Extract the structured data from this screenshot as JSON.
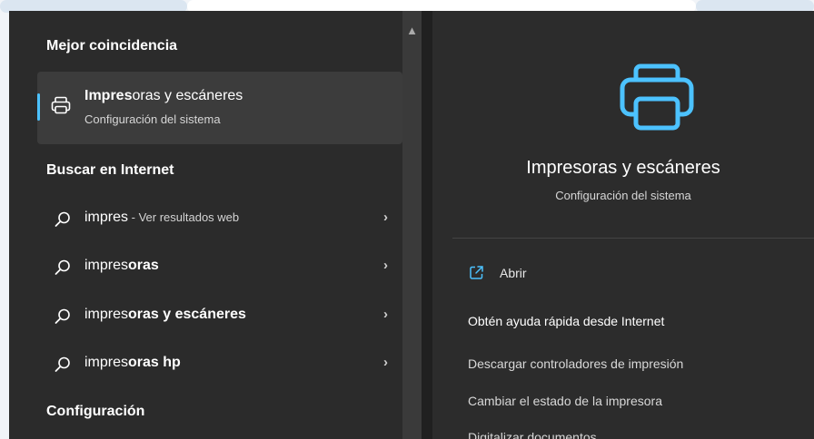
{
  "best_match": {
    "heading": "Mejor coincidencia",
    "title_bold": "Impres",
    "title_rest": "oras y escáneres",
    "subtitle": "Configuración del sistema",
    "icon": "printer-icon"
  },
  "web_search": {
    "heading": "Buscar en Internet",
    "items": [
      {
        "normal": "impres",
        "bold": "",
        "suffix": " - Ver resultados web"
      },
      {
        "normal": "impres",
        "bold": "oras",
        "suffix": ""
      },
      {
        "normal": "impres",
        "bold": "oras y escáneres",
        "suffix": ""
      },
      {
        "normal": "impres",
        "bold": "oras hp",
        "suffix": ""
      }
    ]
  },
  "settings": {
    "heading": "Configuración"
  },
  "preview": {
    "title": "Impresoras y escáneres",
    "subtitle": "Configuración del sistema",
    "open_label": "Abrir",
    "help_heading": "Obtén ayuda rápida desde Internet",
    "help_links": [
      "Descargar controladores de impresión",
      "Cambiar el estado de la impresora",
      "Digitalizar documentos"
    ]
  },
  "colors": {
    "accent": "#4cc2ff",
    "panel": "#2b2b2b",
    "selected": "#3c3c3c"
  }
}
